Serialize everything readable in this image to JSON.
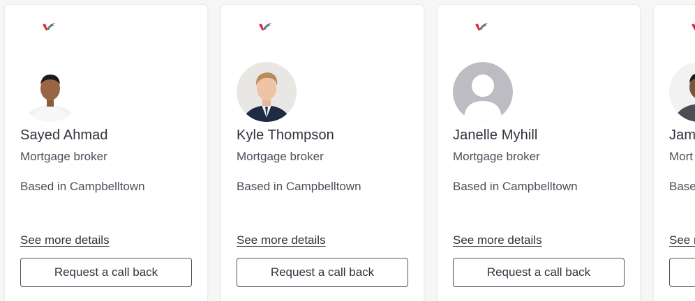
{
  "brokers": [
    {
      "name": "Sayed Ahmad",
      "role": "Mortgage broker",
      "location": "Based in Campbelltown",
      "details_link": "See more details",
      "callback_label": "Request a call back",
      "photo": "photo"
    },
    {
      "name": "Kyle Thompson",
      "role": "Mortgage broker",
      "location": "Based in Campbelltown",
      "details_link": "See more details",
      "callback_label": "Request a call back",
      "photo": "photo"
    },
    {
      "name": "Janelle Myhill",
      "role": "Mortgage broker",
      "location": "Based in Campbelltown",
      "details_link": "See more details",
      "callback_label": "Request a call back",
      "photo": "placeholder"
    },
    {
      "name": "Jam",
      "role": "Mort",
      "location": "Base",
      "details_link": "See m",
      "callback_label": "",
      "photo": "photo"
    }
  ],
  "icons": {
    "brand_logo": "brand-logo-icon",
    "placeholder_avatar": "user-placeholder-icon"
  },
  "colors": {
    "logo_red": "#d6263b",
    "logo_teal": "#1aa6a6",
    "placeholder_gray": "#bdbcc2"
  }
}
